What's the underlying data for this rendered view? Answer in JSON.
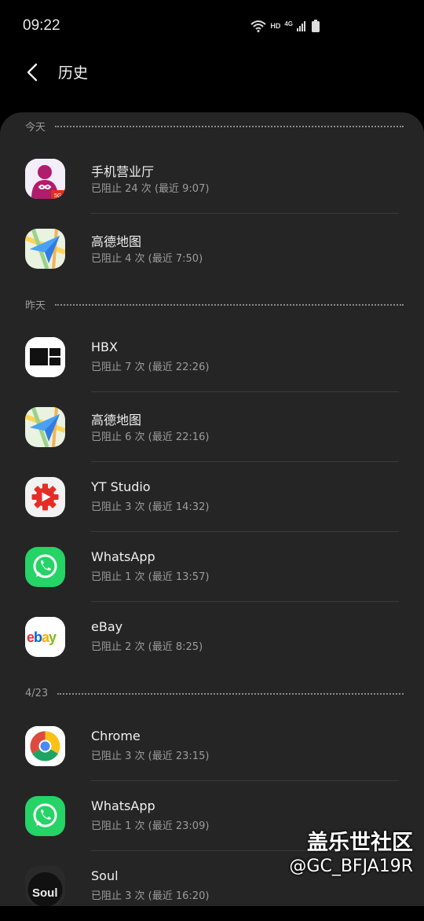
{
  "status_bar": {
    "time": "09:22",
    "hd": "HD",
    "network": "4G"
  },
  "header": {
    "title": "历史"
  },
  "sections": [
    {
      "label": "今天",
      "items": [
        {
          "name": "手机营业厅",
          "detail": "已阻止 24 次 (最近 9:07)",
          "icon": "china-unicom-icon"
        },
        {
          "name": "高德地图",
          "detail": "已阻止 4 次 (最近 7:50)",
          "icon": "amap-icon"
        }
      ]
    },
    {
      "label": "昨天",
      "items": [
        {
          "name": "HBX",
          "detail": "已阻止 7 次 (最近 22:26)",
          "icon": "hbx-icon"
        },
        {
          "name": "高德地图",
          "detail": "已阻止 6 次 (最近 22:16)",
          "icon": "amap-icon"
        },
        {
          "name": "YT Studio",
          "detail": "已阻止 3 次 (最近 14:32)",
          "icon": "yt-studio-icon"
        },
        {
          "name": "WhatsApp",
          "detail": "已阻止 1 次 (最近 13:57)",
          "icon": "whatsapp-icon"
        },
        {
          "name": "eBay",
          "detail": "已阻止 2 次 (最近 8:25)",
          "icon": "ebay-icon"
        }
      ]
    },
    {
      "label": "4/23",
      "items": [
        {
          "name": "Chrome",
          "detail": "已阻止 3 次 (最近 23:15)",
          "icon": "chrome-icon"
        },
        {
          "name": "WhatsApp",
          "detail": "已阻止 1 次 (最近 23:09)",
          "icon": "whatsapp-icon"
        },
        {
          "name": "Soul",
          "detail": "已阻止 3 次 (最近 16:20)",
          "icon": "soul-icon"
        }
      ]
    }
  ],
  "watermark": {
    "line1": "盖乐世社区",
    "line2": "@GC_BFJA19R"
  }
}
